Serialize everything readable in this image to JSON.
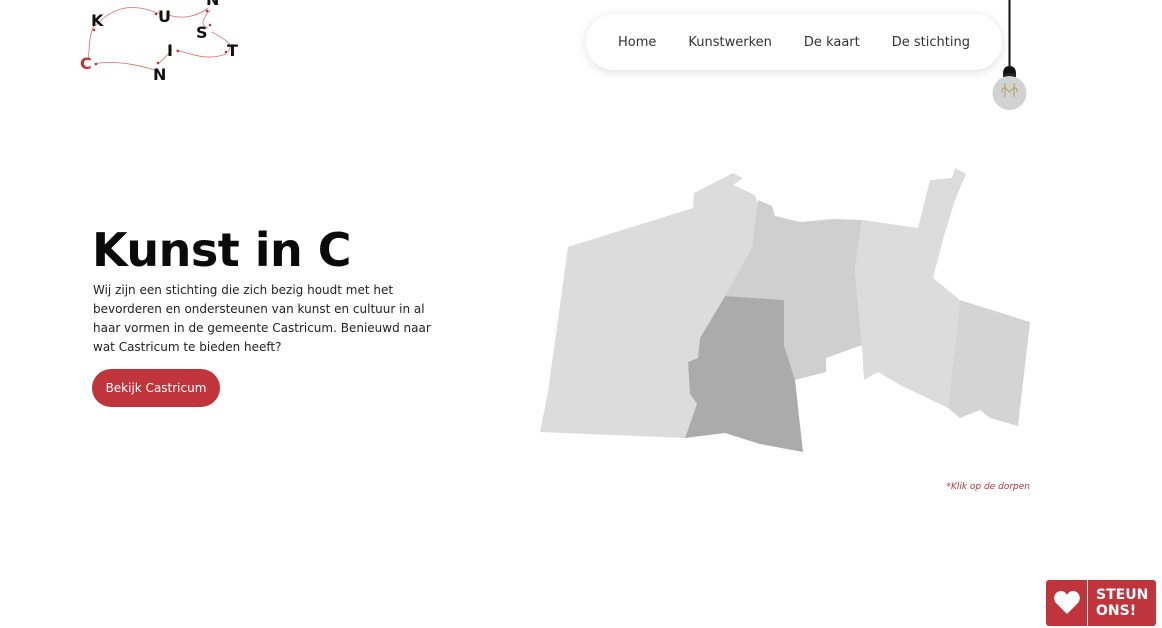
{
  "logo": {
    "letters": {
      "k": "K",
      "u": "U",
      "n_top": "N",
      "s": "S",
      "i": "I",
      "t": "T",
      "c": "C",
      "n_bottom": "N"
    },
    "accent_color": "#c0343b"
  },
  "nav": {
    "items": [
      {
        "label": "Home"
      },
      {
        "label": "Kunstwerken"
      },
      {
        "label": "De kaart"
      },
      {
        "label": "De stichting"
      }
    ]
  },
  "lamp": {
    "icon": "lightbulb-icon"
  },
  "hero": {
    "title": "Kunst in C",
    "text": "Wij zijn een stichting die zich bezig houdt met het bevorderen en ondersteunen van kunst en cultuur in al haar vormen in de gemeente Castricum. Benieuwd naar wat Castricum te bieden heeft?",
    "button_label": "Bekijk Castricum"
  },
  "map": {
    "hint": "*Klik op de dorpen",
    "colors": {
      "light": "#dcdcdc",
      "medium": "#cfcfcf",
      "dark": "#ababab"
    }
  },
  "support": {
    "label": "STEUN\nONS!",
    "icon": "heart-icon",
    "color": "#c0343b"
  }
}
